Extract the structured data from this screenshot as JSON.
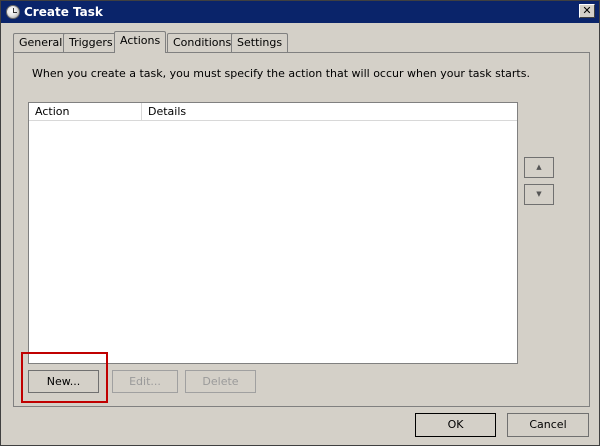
{
  "window": {
    "title": "Create Task"
  },
  "tabs": [
    {
      "label": "General"
    },
    {
      "label": "Triggers"
    },
    {
      "label": "Actions"
    },
    {
      "label": "Conditions"
    },
    {
      "label": "Settings"
    }
  ],
  "active_tab": "Actions",
  "actions_panel": {
    "intro": "When you create a task, you must specify the action that will occur when your task starts.",
    "columns": [
      "Action",
      "Details"
    ],
    "rows": [],
    "new_label": "New...",
    "edit_label": "Edit...",
    "delete_label": "Delete",
    "move_up_icon": "triangle-up-icon",
    "move_down_icon": "triangle-down-icon"
  },
  "footer": {
    "ok_label": "OK",
    "cancel_label": "Cancel"
  },
  "colors": {
    "titlebar": "#0a246a",
    "dialog": "#d4d0c8",
    "highlight": "#c00000"
  }
}
